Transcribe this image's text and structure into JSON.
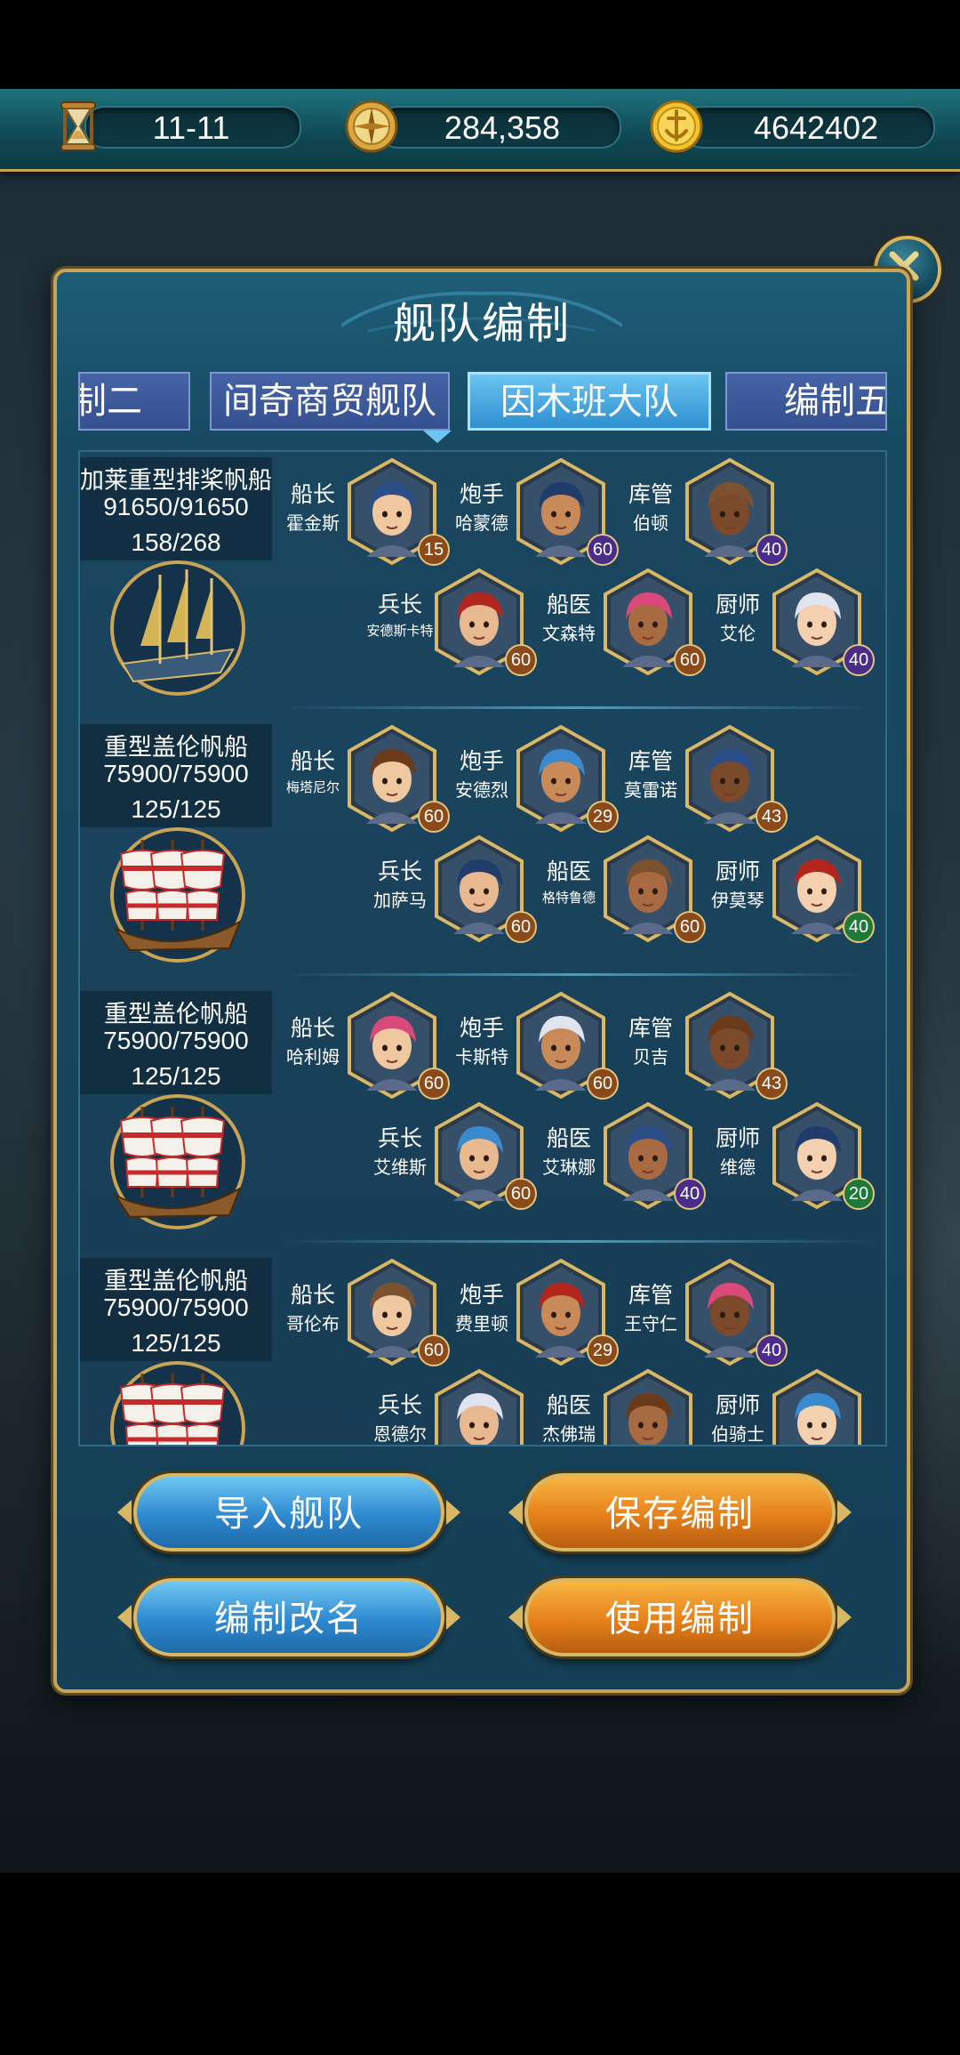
{
  "topbar": {
    "date": "11-11",
    "compass_value": "284,358",
    "coins": "4642402",
    "icons": [
      "hourglass-icon",
      "compass-icon",
      "gold-coin-icon"
    ]
  },
  "panel": {
    "title": "舰队编制",
    "tabs": [
      {
        "label": "制二",
        "active": false
      },
      {
        "label": "间奇商贸舰队",
        "active": false
      },
      {
        "label": "因木班大队",
        "active": true
      },
      {
        "label": "编制五",
        "active": false
      }
    ],
    "colors": {
      "blue_level": "#4a2d8a",
      "brown_level": "#8a4a1a",
      "green_level": "#1f7a3a",
      "gold_border": "#c9a455"
    }
  },
  "ships": [
    {
      "name": "加莱重型排桨帆船",
      "durability": "91650/91650",
      "capacity": "158/268",
      "crew": [
        {
          "role": "船长",
          "name": "霍金斯",
          "level": "15",
          "badge": "brown"
        },
        {
          "role": "炮手",
          "name": "哈蒙德",
          "level": "60",
          "badge": "purple"
        },
        {
          "role": "库管",
          "name": "伯顿",
          "level": "40",
          "badge": "purple"
        },
        {
          "role": "兵长",
          "name": "安德斯卡特",
          "level": "60",
          "badge": "brown"
        },
        {
          "role": "船医",
          "name": "文森特",
          "level": "60",
          "badge": "brown"
        },
        {
          "role": "厨师",
          "name": "艾伦",
          "level": "40",
          "badge": "purple"
        }
      ]
    },
    {
      "name": "重型盖伦帆船",
      "durability": "75900/75900",
      "capacity": "125/125",
      "crew": [
        {
          "role": "船长",
          "name": "梅塔尼尔",
          "level": "60",
          "badge": "brown"
        },
        {
          "role": "炮手",
          "name": "安德烈",
          "level": "29",
          "badge": "brown"
        },
        {
          "role": "库管",
          "name": "莫雷诺",
          "level": "43",
          "badge": "brown"
        },
        {
          "role": "兵长",
          "name": "加萨马",
          "level": "60",
          "badge": "brown"
        },
        {
          "role": "船医",
          "name": "格特鲁德",
          "level": "60",
          "badge": "brown"
        },
        {
          "role": "厨师",
          "name": "伊莫琴",
          "level": "40",
          "badge": "green"
        }
      ]
    },
    {
      "name": "重型盖伦帆船",
      "durability": "75900/75900",
      "capacity": "125/125",
      "crew": [
        {
          "role": "船长",
          "name": "哈利姆",
          "level": "60",
          "badge": "brown"
        },
        {
          "role": "炮手",
          "name": "卡斯特",
          "level": "60",
          "badge": "brown"
        },
        {
          "role": "库管",
          "name": "贝吉",
          "level": "43",
          "badge": "brown"
        },
        {
          "role": "兵长",
          "name": "艾维斯",
          "level": "60",
          "badge": "brown"
        },
        {
          "role": "船医",
          "name": "艾琳娜",
          "level": "40",
          "badge": "purple"
        },
        {
          "role": "厨师",
          "name": "维德",
          "level": "20",
          "badge": "green"
        }
      ]
    },
    {
      "name": "重型盖伦帆船",
      "durability": "75900/75900",
      "capacity": "125/125",
      "crew": [
        {
          "role": "船长",
          "name": "哥伦布",
          "level": "60",
          "badge": "brown"
        },
        {
          "role": "炮手",
          "name": "费里顿",
          "level": "29",
          "badge": "brown"
        },
        {
          "role": "库管",
          "name": "王守仁",
          "level": "40",
          "badge": "purple"
        },
        {
          "role": "兵长",
          "name": "恩德尔",
          "level": "",
          "badge": "brown"
        },
        {
          "role": "船医",
          "name": "杰佛瑞",
          "level": "",
          "badge": "brown"
        },
        {
          "role": "厨师",
          "name": "伯骑士",
          "level": "",
          "badge": "brown"
        }
      ]
    }
  ],
  "buttons": {
    "import": "导入舰队",
    "save": "保存编制",
    "rename": "编制改名",
    "use": "使用编制"
  }
}
